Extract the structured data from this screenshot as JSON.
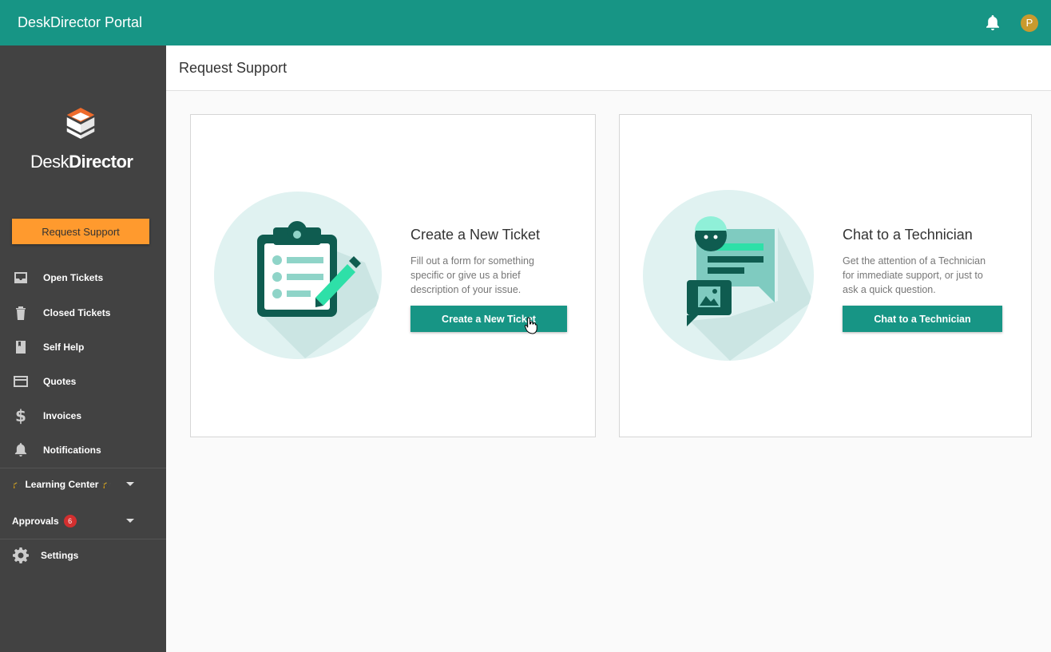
{
  "header": {
    "title": "DeskDirector Portal",
    "avatar_initial": "P"
  },
  "sidebar": {
    "logo_text_light": "Desk",
    "logo_text_bold": "Director",
    "request_button": "Request Support",
    "items": [
      {
        "label": "Open Tickets",
        "icon": "inbox-icon"
      },
      {
        "label": "Closed Tickets",
        "icon": "trash-icon"
      },
      {
        "label": "Self Help",
        "icon": "book-icon"
      },
      {
        "label": "Quotes",
        "icon": "credit-card-icon"
      },
      {
        "label": "Invoices",
        "icon": "dollar-icon"
      },
      {
        "label": "Notifications",
        "icon": "bell-icon"
      }
    ],
    "learning_center": "Learning Center",
    "approvals": {
      "label": "Approvals",
      "count": "6"
    },
    "settings": "Settings"
  },
  "page": {
    "title": "Request Support"
  },
  "cards": [
    {
      "title": "Create a New Ticket",
      "description": "Fill out a form for something specific or give us a brief description of your issue.",
      "button": "Create a New Ticket"
    },
    {
      "title": "Chat to a Technician",
      "description": "Get the attention of a Technician for immediate support, or just to ask a quick question.",
      "button": "Chat to a Technician"
    }
  ],
  "colors": {
    "primary": "#179585",
    "accent": "#ff9a2e",
    "sidebar": "#424242",
    "badge": "#d32f2f"
  }
}
